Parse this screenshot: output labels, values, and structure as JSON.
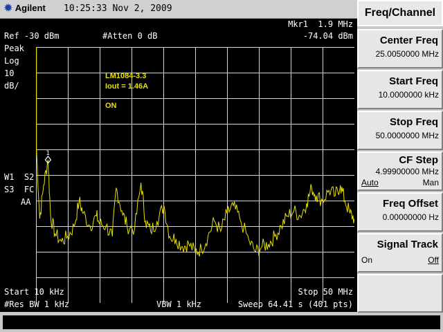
{
  "header": {
    "brand": "Agilent",
    "datetime": "10:25:33  Nov 2, 2009"
  },
  "screen": {
    "marker_label": "Mkr1  1.9 MHz",
    "marker_value": "-74.04 dBm",
    "ref_level": "Ref -30 dBm",
    "atten": "#Atten 0 dB",
    "detector": "Peak",
    "scale_type": "Log",
    "scale_value": "10",
    "scale_unit": "dB/",
    "trace_w1": "W1  S2",
    "trace_s3": "S3  FC",
    "trace_aa": "AA",
    "annot_line1": "LM1084-3.3",
    "annot_line2": "Iout = 1.46A",
    "annot_line3": "ON",
    "marker_number": "1",
    "start": "Start 10 kHz",
    "stop": "Stop 50 MHz",
    "res_bw": "#Res BW 1 kHz",
    "vbw": "VBW 1 kHz",
    "sweep": "Sweep 64.41 s (401 pts)"
  },
  "softkeys": {
    "title": "Freq/Channel",
    "center_label": "Center Freq",
    "center_value": "25.0050000 MHz",
    "start_label": "Start Freq",
    "start_value": "10.0000000 kHz",
    "stop_label": "Stop Freq",
    "stop_value": "50.0000000 MHz",
    "cfstep_label": "CF Step",
    "cfstep_value": "4.99900000 MHz",
    "cfstep_auto": "Auto",
    "cfstep_man": "Man",
    "offset_label": "Freq Offset",
    "offset_value": "0.00000000  Hz",
    "track_label": "Signal Track",
    "track_on": "On",
    "track_off": "Off"
  },
  "colors": {
    "trace": "#e8e000",
    "grid": "#d8d8d8",
    "background": "#000000"
  },
  "chart_data": {
    "type": "line",
    "xlim": [
      0.01,
      50
    ],
    "ylim": [
      -130,
      -30
    ],
    "x_unit": "MHz",
    "y_unit": "dBm",
    "points": [
      [
        0.01,
        -66
      ],
      [
        0.6,
        -97
      ],
      [
        1.2,
        -84
      ],
      [
        1.9,
        -74.04
      ],
      [
        2.3,
        -96
      ],
      [
        3,
        -103
      ],
      [
        4,
        -106
      ],
      [
        5,
        -104
      ],
      [
        6,
        -100
      ],
      [
        6.8,
        -90
      ],
      [
        7.4,
        -95
      ],
      [
        8.5,
        -100
      ],
      [
        9.5,
        -96
      ],
      [
        10,
        -99
      ],
      [
        11,
        -100
      ],
      [
        12,
        -104
      ],
      [
        12.6,
        -85
      ],
      [
        13.5,
        -94
      ],
      [
        14.3,
        -100
      ],
      [
        15.5,
        -101
      ],
      [
        16.5,
        -83
      ],
      [
        17.2,
        -98
      ],
      [
        18,
        -102
      ],
      [
        19,
        -98
      ],
      [
        20.1,
        -92
      ],
      [
        21,
        -104
      ],
      [
        22,
        -105
      ],
      [
        23,
        -108
      ],
      [
        24,
        -107
      ],
      [
        25,
        -110
      ],
      [
        26,
        -109
      ],
      [
        27,
        -104
      ],
      [
        28,
        -98
      ],
      [
        29,
        -102
      ],
      [
        30,
        -95
      ],
      [
        31,
        -92
      ],
      [
        32,
        -97
      ],
      [
        33.5,
        -106
      ],
      [
        34.5,
        -110
      ],
      [
        35.5,
        -108
      ],
      [
        36.5,
        -107
      ],
      [
        37.5,
        -104
      ],
      [
        38.5,
        -100
      ],
      [
        39.5,
        -96
      ],
      [
        40.5,
        -94
      ],
      [
        41.5,
        -96
      ],
      [
        42.5,
        -91
      ],
      [
        43.3,
        -85
      ],
      [
        44,
        -88
      ],
      [
        45,
        -90
      ],
      [
        46,
        -86
      ],
      [
        47,
        -88
      ],
      [
        47.8,
        -84
      ],
      [
        48.5,
        -90
      ],
      [
        49.3,
        -95
      ],
      [
        50,
        -97
      ]
    ]
  }
}
